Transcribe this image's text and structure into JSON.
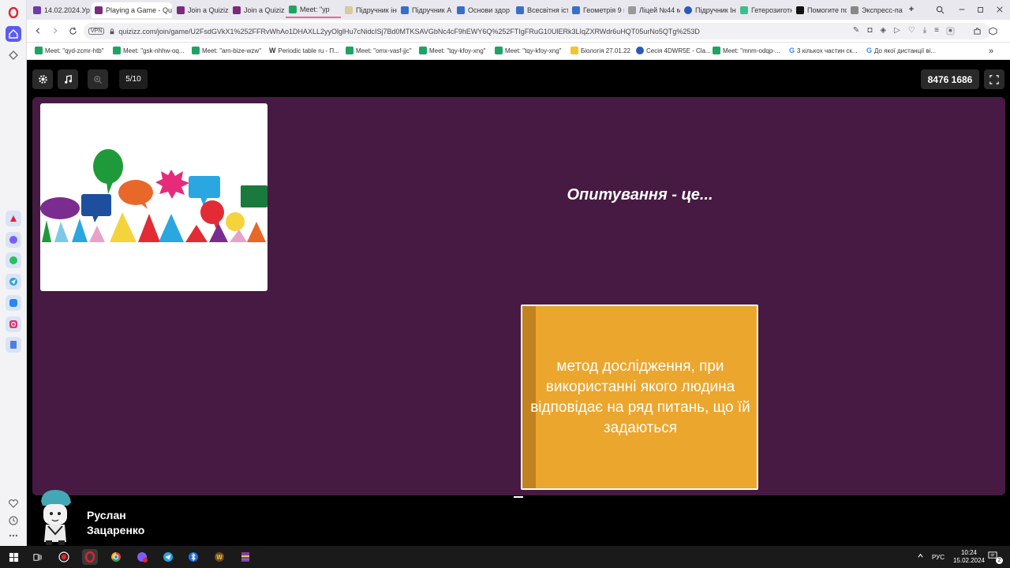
{
  "browser": {
    "tabs": [
      {
        "label": "14.02.2024.Ур"
      },
      {
        "label": "Playing a Game - Quizizz",
        "active": true
      },
      {
        "label": "Join a Quizizz"
      },
      {
        "label": "Join a Quizizz"
      },
      {
        "label": "Meet: \"ур"
      },
      {
        "label": "Підручник інф"
      },
      {
        "label": "Підручник А"
      },
      {
        "label": "Основи здор"
      },
      {
        "label": "Всесвітня істо"
      },
      {
        "label": "Геометрія 9 к"
      },
      {
        "label": "Ліцей №44 м"
      },
      {
        "label": "Підручник Ін"
      },
      {
        "label": "Гетерозиготн"
      },
      {
        "label": "Помогите по"
      },
      {
        "label": "Экспресс-пан"
      }
    ],
    "new_tab": "+",
    "vpn_label": "VPN",
    "url": "quizizz.com/join/game/U2FsdGVkX1%252FFRvWhAo1DHAXLL2yyOlglHu7cNidcISj7Bd0MTKSAVGbNc4cF9hEWY6Q%252FTIgFRuG10UlERk3LIqZXRWdr6uHQT05urNo5QTg%253D",
    "bookmarks": [
      "Meet: \"qyd-zcmr-htb\"",
      "Meet: \"gsk-nhhw-oq...",
      "Meet: \"arn-bize-wzw\"",
      "Periodic table ru - П...",
      "Meet: \"omx-vasf-jjc\"",
      "Meet: \"tqy-kfoy-xng\"",
      "Meet: \"tqy-kfoy-xng\"",
      "Біологія 27.01.22",
      "Сесія 4DWR5E - Cla...",
      "Meet: \"mnm-odqp-...",
      "3 кількох частин ск...",
      "До якої дистанції ві..."
    ],
    "bookmarks_more": "»"
  },
  "quiz": {
    "progress": "5/10",
    "game_code": "8476 1686",
    "question": "Опитування - це...",
    "answer": "метод дослідження, при використанні якого людина відповідає на ряд питань, що їй задаються",
    "player_first": "Руслан",
    "player_last": "Зацаренко"
  },
  "taskbar": {
    "lang": "РУС",
    "time": "10:24",
    "date": "15.02.2024",
    "notifications": "2"
  },
  "colors": {
    "panel": "#461a42",
    "answer_card": "#eba62d",
    "answer_stripe": "#c0831f"
  }
}
